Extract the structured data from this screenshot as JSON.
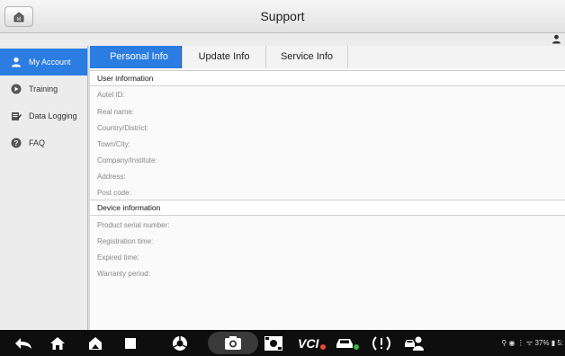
{
  "header": {
    "title": "Support"
  },
  "sidebar": {
    "items": [
      {
        "label": "My Account",
        "icon": "person-icon",
        "active": true
      },
      {
        "label": "Training",
        "icon": "play-circle-icon",
        "active": false
      },
      {
        "label": "Data Logging",
        "icon": "edit-note-icon",
        "active": false
      },
      {
        "label": "FAQ",
        "icon": "question-icon",
        "active": false
      }
    ]
  },
  "tabs": [
    {
      "label": "Personal Info",
      "active": true
    },
    {
      "label": "Update Info",
      "active": false
    },
    {
      "label": "Service Info",
      "active": false
    }
  ],
  "user_info": {
    "header": "User information",
    "fields": [
      "Autel ID:",
      "Real name:",
      "Country/District:",
      "Town/City:",
      "Company/Institute:",
      "Address:",
      "Post code:"
    ]
  },
  "device_info": {
    "header": "Device information",
    "fields": [
      "Product serial number:",
      "Registration time:",
      "Expired time:",
      "Warranty period:"
    ]
  },
  "status_bar": {
    "text": "37%",
    "time": "5:"
  },
  "colors": {
    "accent": "#2b7de1",
    "navbar": "#0e0e0e"
  }
}
